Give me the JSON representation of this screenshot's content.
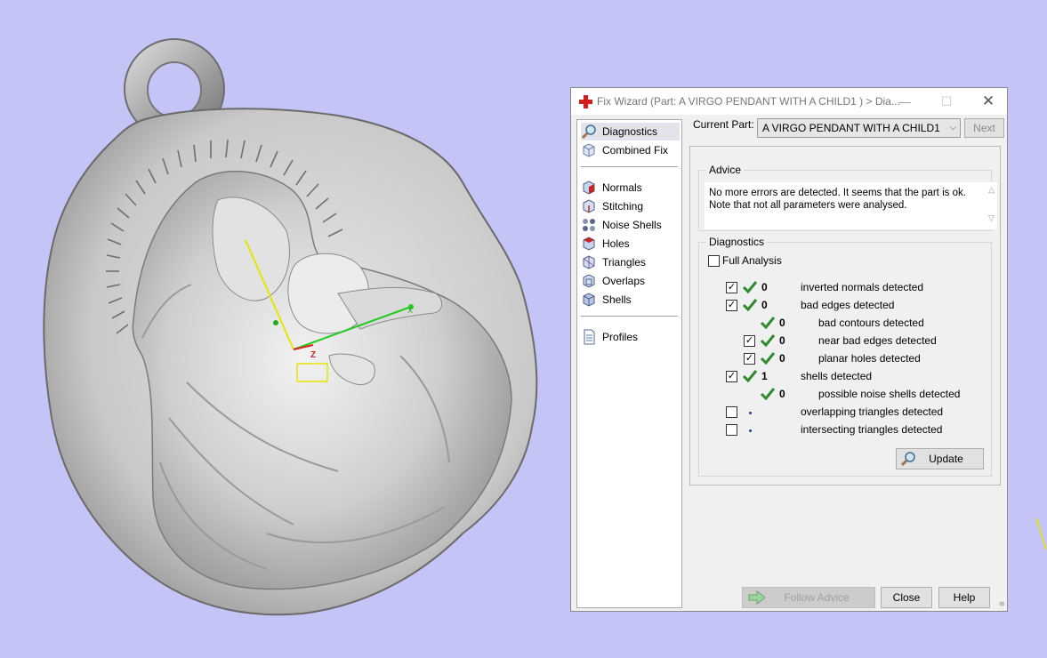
{
  "window": {
    "title": "Fix Wizard (Part: A VIRGO PENDANT WITH A CHILD1 ) > Dia...",
    "minimize": "—",
    "maximize": "☐",
    "close": "✕"
  },
  "nav": {
    "group1": [
      {
        "label": "Diagnostics",
        "icon": "magnifier-icon",
        "selected": true
      },
      {
        "label": "Combined Fix",
        "icon": "cube-icon"
      }
    ],
    "group2": [
      {
        "label": "Normals",
        "icon": "normals-cube-icon"
      },
      {
        "label": "Stitching",
        "icon": "stitching-cube-icon"
      },
      {
        "label": "Noise Shells",
        "icon": "noise-shells-icon"
      },
      {
        "label": "Holes",
        "icon": "holes-cube-icon"
      },
      {
        "label": "Triangles",
        "icon": "triangles-cube-icon"
      },
      {
        "label": "Overlaps",
        "icon": "overlaps-cube-icon"
      },
      {
        "label": "Shells",
        "icon": "shells-cube-icon"
      }
    ],
    "group3": [
      {
        "label": "Profiles",
        "icon": "document-icon"
      }
    ]
  },
  "current_part": {
    "label": "Current Part:",
    "value": "A VIRGO PENDANT WITH A CHILD1",
    "next": "Next"
  },
  "advice": {
    "title": "Advice",
    "line1": "No more errors are detected. It seems that the part is ok.",
    "line2": "Note that not all parameters were analysed."
  },
  "diagnostics": {
    "title": "Diagnostics",
    "full_analysis": "Full Analysis",
    "rows": [
      {
        "checked": true,
        "status": "ok",
        "count": "0",
        "label": "inverted normals detected",
        "indent": 0
      },
      {
        "checked": true,
        "status": "ok",
        "count": "0",
        "label": "bad edges detected",
        "indent": 0
      },
      {
        "checkbox": false,
        "status": "ok",
        "count": "0",
        "label": "bad contours detected",
        "indent": 1
      },
      {
        "checked": true,
        "status": "ok",
        "count": "0",
        "label": "near bad edges detected",
        "indent": 1
      },
      {
        "checked": true,
        "status": "ok",
        "count": "0",
        "label": "planar holes detected",
        "indent": 1
      },
      {
        "checked": true,
        "status": "ok",
        "count": "1",
        "label": "shells detected",
        "indent": 0
      },
      {
        "checkbox": false,
        "status": "ok",
        "count": "0",
        "label": "possible noise shells detected",
        "indent": 1
      },
      {
        "checked": false,
        "status": "not-analysed",
        "count": "",
        "label": "overlapping triangles detected",
        "indent": 0
      },
      {
        "checked": false,
        "status": "not-analysed",
        "count": "",
        "label": "intersecting triangles detected",
        "indent": 0
      }
    ],
    "update": "Update"
  },
  "footer": {
    "follow_advice": "Follow Advice",
    "close": "Close",
    "help": "Help"
  },
  "viewport": {
    "axis_z": "Z",
    "axis_x": "X",
    "background": "#c4c4f6"
  }
}
